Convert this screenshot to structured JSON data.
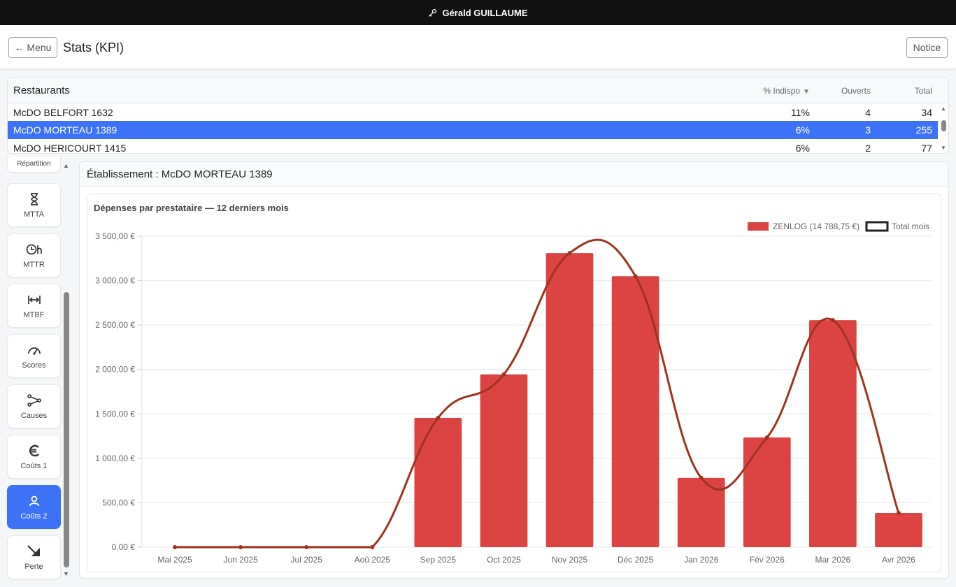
{
  "topbar": {
    "user": "Gérald GUILLAUME",
    "icon": "key-icon"
  },
  "header": {
    "menu_label": "← Menu",
    "title": "Stats (KPI)",
    "notice_label": "Notice"
  },
  "restaurants": {
    "title": "Restaurants",
    "columns": {
      "indispo": "% Indispo",
      "ouverts": "Ouverts",
      "total": "Total"
    },
    "rows": [
      {
        "name": "McDO BELFORT 1632",
        "indispo": "11%",
        "ouverts": "4",
        "total": "34"
      },
      {
        "name": "McDO MORTEAU 1389",
        "indispo": "6%",
        "ouverts": "3",
        "total": "255",
        "selected": true
      },
      {
        "name": "McDO HERICOURT 1415",
        "indispo": "6%",
        "ouverts": "2",
        "total": "77"
      }
    ]
  },
  "sidebar": {
    "items": [
      {
        "label": "Répartition",
        "icon": "pie-chart-icon"
      },
      {
        "label": "MTTA",
        "icon": "hourglass-icon"
      },
      {
        "label": "MTTR",
        "icon": "clock-hours-icon"
      },
      {
        "label": "MTBF",
        "icon": "arrows-horizontal-icon"
      },
      {
        "label": "Scores",
        "icon": "gauge-icon"
      },
      {
        "label": "Causes",
        "icon": "share-nodes-icon"
      },
      {
        "label": "Coûts 1",
        "icon": "euro-icon"
      },
      {
        "label": "Coûts 2",
        "icon": "user-icon",
        "active": true
      },
      {
        "label": "Perte",
        "icon": "loss-arrow-icon"
      }
    ],
    "active_color": "#3d72f6"
  },
  "main": {
    "title": "Établissement : McDO MORTEAU 1389"
  },
  "chart_data": {
    "type": "bar",
    "title": "Dépenses par prestataire — 12 derniers mois",
    "categories": [
      "Mai 2025",
      "Jun 2025",
      "Jul 2025",
      "Aoû 2025",
      "Sep 2025",
      "Oct 2025",
      "Nov 2025",
      "Déc 2025",
      "Jan 2026",
      "Fév 2026",
      "Mar 2026",
      "Avr 2026"
    ],
    "series": [
      {
        "name": "ZENLOG (14 788,75 €)",
        "type": "bar",
        "color": "#dc4444",
        "values": [
          0,
          0,
          0,
          0,
          1455,
          1945,
          3310,
          3050,
          780,
          1235,
          2555,
          385
        ]
      },
      {
        "name": "Total mois",
        "type": "line",
        "color": "#a0331f",
        "values": [
          0,
          0,
          0,
          0,
          1455,
          1945,
          3310,
          3050,
          780,
          1235,
          2555,
          385
        ]
      }
    ],
    "yticks": [
      "0,00 €",
      "500,00 €",
      "1 000,00 €",
      "1 500,00 €",
      "2 000,00 €",
      "2 500,00 €",
      "3 000,00 €",
      "3 500,00 €"
    ],
    "ylim": [
      0,
      3500
    ],
    "legend": "top-right",
    "grid": true
  }
}
